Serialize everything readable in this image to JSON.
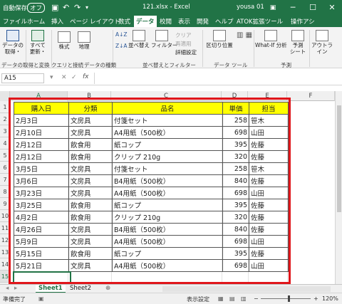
{
  "titlebar": {
    "autosave": "自動保存",
    "autosave_state": "オフ",
    "filename": "121.xlsx  -  Excel",
    "user": "yousa 01"
  },
  "tabs": [
    "ファイル",
    "ホーム",
    "挿入",
    "ページ レイアウト",
    "数式",
    "データ",
    "校閲",
    "表示",
    "開発",
    "ヘルプ",
    "ATOK拡張ツール",
    "操作アシ"
  ],
  "active_tab": "データ",
  "ribbon": {
    "get_data": "データの\n取得・",
    "refresh_all": "すべて\n更新・",
    "stocks": "株式",
    "geography": "地理",
    "sort_asc": "A↓Z",
    "sort_desc": "Z↓A",
    "sort": "並べ替え",
    "filter": "フィルター",
    "clear": "クリア",
    "reapply": "再適用",
    "advanced": "詳細設定",
    "text_to_columns": "区切り位置",
    "whatif": "What-If 分析",
    "forecast_sheet": "予測\nシート",
    "outline": "アウトラ\nイン",
    "groups": {
      "get_transform": "データの取得と変換",
      "queries": "クエリと接続",
      "data_types": "データの種類",
      "sort_filter": "並べ替えとフィルター",
      "data_tools": "データ ツール",
      "forecast": "予測"
    }
  },
  "formula_bar": {
    "name_box": "A15",
    "fx": "fx",
    "value": ""
  },
  "columns": [
    "A",
    "B",
    "C",
    "D",
    "E",
    "F"
  ],
  "rows": [
    "1",
    "2",
    "3",
    "4",
    "5",
    "6",
    "7",
    "8",
    "9",
    "10",
    "11",
    "12",
    "13",
    "14",
    "15"
  ],
  "table": {
    "headers": [
      "購入日",
      "分類",
      "品名",
      "単価",
      "担当"
    ],
    "rows": [
      [
        "2月3日",
        "文房具",
        "付箋セット",
        "258",
        "笹木"
      ],
      [
        "2月10日",
        "文房具",
        "A4用紙（500枚）",
        "698",
        "山田"
      ],
      [
        "2月12日",
        "飲食用",
        "紙コップ",
        "395",
        "佐藤"
      ],
      [
        "2月12日",
        "飲食用",
        "クリップ 210g",
        "320",
        "佐藤"
      ],
      [
        "3月5日",
        "文房具",
        "付箋セット",
        "258",
        "笹木"
      ],
      [
        "3月6日",
        "文房具",
        "B4用紙（500枚）",
        "840",
        "佐藤"
      ],
      [
        "3月23日",
        "文房具",
        "A4用紙（500枚）",
        "698",
        "山田"
      ],
      [
        "3月25日",
        "飲食用",
        "紙コップ",
        "395",
        "佐藤"
      ],
      [
        "4月2日",
        "飲食用",
        "クリップ 210g",
        "320",
        "佐藤"
      ],
      [
        "4月26日",
        "文房具",
        "B4用紙（500枚）",
        "840",
        "佐藤"
      ],
      [
        "5月9日",
        "文房具",
        "A4用紙（500枚）",
        "698",
        "山田"
      ],
      [
        "5月15日",
        "飲食用",
        "紙コップ",
        "395",
        "佐藤"
      ],
      [
        "5月21日",
        "文房具",
        "A4用紙（500枚）",
        "698",
        "山田"
      ]
    ]
  },
  "sheets": [
    "Sheet1",
    "Sheet2"
  ],
  "status": {
    "ready": "準備完了",
    "display_settings": "表示設定",
    "zoom": "120%"
  },
  "colors": {
    "excel_green": "#217346",
    "header_fill": "#ffff00",
    "highlight_border": "#e0161b"
  }
}
